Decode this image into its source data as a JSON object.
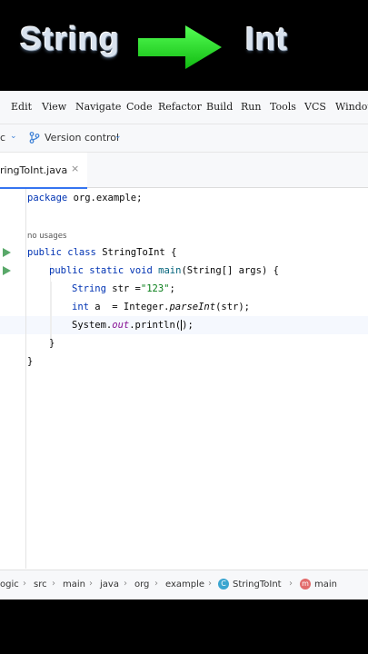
{
  "banner": {
    "left_word": "String",
    "right_word": "Int",
    "arrow_color": "#22dd22"
  },
  "menu": {
    "items": [
      "Edit",
      "View",
      "Navigate",
      "Code",
      "Refactor",
      "Build",
      "Run",
      "Tools",
      "VCS",
      "Window"
    ]
  },
  "toolbar": {
    "project_fragment": "c",
    "version_control": "Version control"
  },
  "tab": {
    "label": "ringToInt.java",
    "close": "×"
  },
  "editor": {
    "line1_kw": "package",
    "line1_rest": " org.example;",
    "usages": "no usages",
    "l3_kw1": "public",
    "l3_kw2": "class",
    "l3_name": "StringToInt",
    "l3_brace": " {",
    "l4_kw1": "public",
    "l4_kw2": "static",
    "l4_kw3": "void",
    "l4_name": "main",
    "l4_params": "(String[] args) {",
    "l5_type": "String",
    "l5_var": " str =",
    "l5_str": "\"123\"",
    "l5_end": ";",
    "l6_kw": "int",
    "l6_var": " a  = Integer.",
    "l6_method": "parseInt",
    "l6_end": "(str);",
    "l7_obj": "System.",
    "l7_field": "out",
    "l7_call": ".println(",
    "l7_end": ");",
    "l8": "}",
    "l9": "}"
  },
  "breadcrumbs": {
    "items": [
      "ogic",
      "src",
      "main",
      "java",
      "org",
      "example",
      "StringToInt",
      "main"
    ],
    "class_icon_letter": "C",
    "method_icon_letter": "m"
  }
}
